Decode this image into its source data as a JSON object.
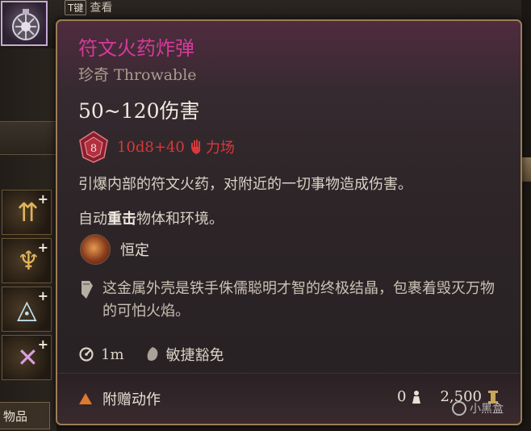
{
  "hud": {
    "hint_key": "T键",
    "hint_label": "查看",
    "bottom_tab": "物品"
  },
  "item": {
    "name": "符文火药炸弹",
    "rarity": "珍奇 Throwable",
    "damage": "50~120伤害",
    "dice_value": "8",
    "damage_formula": "10d8+40",
    "damage_type": "力场",
    "description": "引爆内部的符文火药，对附近的一切事物造成伤害。",
    "extra_prefix": "自动",
    "extra_keyword": "重击",
    "extra_suffix": "物体和环境。",
    "passive": "恒定",
    "flavor": "这金属外壳是铁手侏儒聪明才智的终极结晶，包裹着毁灭万物的可怕火焰。",
    "range": "1m",
    "save": "敏捷豁免",
    "action": "附赠动作",
    "weight": "0",
    "price": "2,500"
  },
  "watermark": "小黑盒",
  "colors": {
    "name": "#d63a9a",
    "damage_formula": "#d63a3a",
    "border": "#9c7e56"
  },
  "icons": {
    "dice": "d8-dice-icon",
    "damage_type": "force-hand-icon",
    "passive": "ember-icon",
    "flavor": "scroll-icon",
    "range": "range-icon",
    "save": "dex-save-icon",
    "action": "bonus-action-triangle-icon",
    "weight": "weight-icon",
    "price": "gold-coin-icon"
  }
}
